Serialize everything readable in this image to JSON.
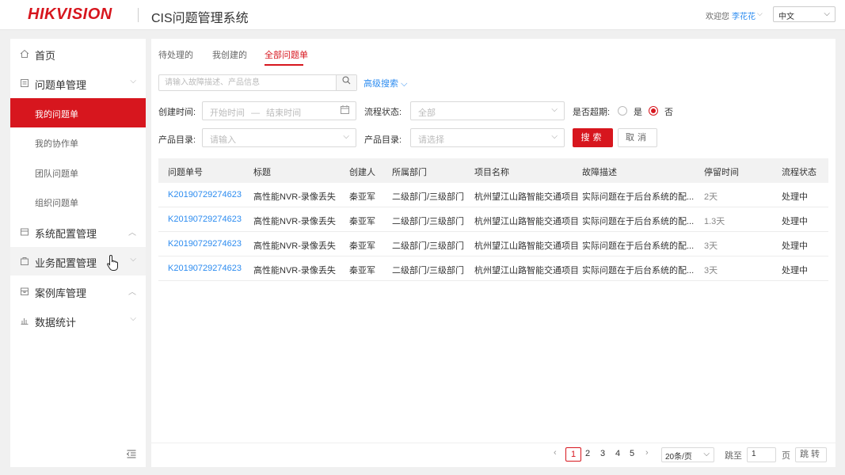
{
  "header": {
    "logo": "HIKVISION",
    "app_title": "CIS问题管理系统",
    "welcome": "欢迎您",
    "username": "李花花",
    "language": "中文"
  },
  "sidebar": {
    "items": [
      {
        "label": "首页",
        "icon": "home-icon"
      },
      {
        "label": "问题单管理",
        "icon": "ticket-icon",
        "expanded": true
      },
      {
        "label": "系统配置管理",
        "icon": "system-icon"
      },
      {
        "label": "业务配置管理",
        "icon": "business-icon"
      },
      {
        "label": "案例库管理",
        "icon": "case-icon"
      },
      {
        "label": "数据统计",
        "icon": "chart-icon"
      }
    ],
    "subitems": [
      {
        "label": "我的问题单",
        "active": true
      },
      {
        "label": "我的协作单"
      },
      {
        "label": "团队问题单"
      },
      {
        "label": "组织问题单"
      }
    ]
  },
  "tabs": [
    {
      "label": "待处理的"
    },
    {
      "label": "我创建的"
    },
    {
      "label": "全部问题单",
      "active": true
    }
  ],
  "search": {
    "placeholder": "请输入故障描述、产品信息",
    "advanced_label": "高级搜索"
  },
  "filters": {
    "created_time_label": "创建时间:",
    "start_placeholder": "开始时间",
    "sep": "—",
    "end_placeholder": "结束时间",
    "flow_status_label": "流程状态:",
    "flow_status_value": "全部",
    "overdue_label": "是否超期:",
    "yes": "是",
    "no": "否",
    "product_dir_label": "产品目录:",
    "product_dir_placeholder": "请输入",
    "product_dir2_label": "产品目录:",
    "product_dir2_placeholder": "请选择",
    "search_button": "搜索",
    "cancel_button": "取消"
  },
  "table": {
    "columns": [
      "问题单号",
      "标题",
      "创建人",
      "所属部门",
      "项目名称",
      "故障描述",
      "停留时间",
      "流程状态"
    ],
    "rows": [
      [
        "K20190729274623",
        "高性能NVR-录像丢失",
        "秦亚军",
        "二级部门/三级部门",
        "杭州望江山路智能交通项目",
        "实际问题在于后台系统的配...",
        "2天",
        "处理中"
      ],
      [
        "K20190729274623",
        "高性能NVR-录像丢失",
        "秦亚军",
        "二级部门/三级部门",
        "杭州望江山路智能交通项目",
        "实际问题在于后台系统的配...",
        "1.3天",
        "处理中"
      ],
      [
        "K20190729274623",
        "高性能NVR-录像丢失",
        "秦亚军",
        "二级部门/三级部门",
        "杭州望江山路智能交通项目",
        "实际问题在于后台系统的配...",
        "3天",
        "处理中"
      ],
      [
        "K20190729274623",
        "高性能NVR-录像丢失",
        "秦亚军",
        "二级部门/三级部门",
        "杭州望江山路智能交通项目",
        "实际问题在于后台系统的配...",
        "3天",
        "处理中"
      ]
    ]
  },
  "pagination": {
    "pages": [
      "1",
      "2",
      "3",
      "4",
      "5"
    ],
    "current": "1",
    "page_size": "20条/页",
    "jump_label": "跳至",
    "jump_value": "1",
    "page_unit": "页",
    "jump_button": "跳转"
  },
  "colors": {
    "brand": "#d7161e",
    "link": "#2d8cf0"
  }
}
